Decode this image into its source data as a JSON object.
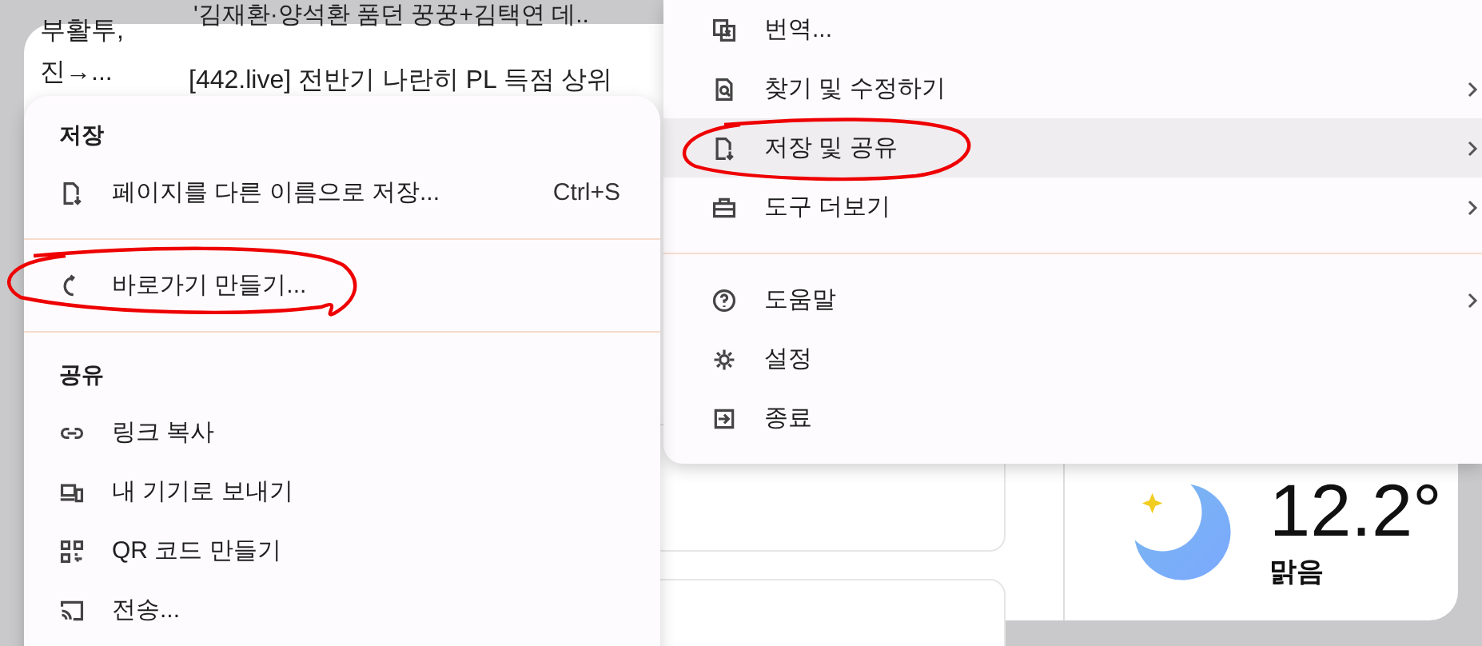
{
  "page": {
    "snippets": [
      "부활투,",
      "진→...",
      "'김재환·양석환 품던 꿍꿍+김택연 데..",
      "[442.live] 전반기 나란히 PL 득점 상위"
    ]
  },
  "weather": {
    "temperature": "12.2°",
    "condition": "맑음"
  },
  "main_menu": {
    "groups": [
      [
        {
          "label": "번역...",
          "submenu": false,
          "selected": false,
          "circled": false
        },
        {
          "label": "찾기 및 수정하기",
          "submenu": true,
          "selected": false,
          "circled": false
        },
        {
          "label": "저장 및 공유",
          "submenu": true,
          "selected": true,
          "circled": true
        },
        {
          "label": "도구 더보기",
          "submenu": true,
          "selected": false,
          "circled": false
        }
      ],
      [
        {
          "label": "도움말",
          "submenu": true,
          "selected": false,
          "circled": false
        },
        {
          "label": "설정",
          "submenu": false,
          "selected": false,
          "circled": false
        },
        {
          "label": "종료",
          "submenu": false,
          "selected": false,
          "circled": false
        }
      ]
    ]
  },
  "save_share_menu": {
    "sections": [
      {
        "title": "저장",
        "items": [
          {
            "label": "페이지를 다른 이름으로 저장...",
            "shortcut": "Ctrl+S",
            "circled": false
          }
        ]
      },
      {
        "items": [
          {
            "label": "바로가기 만들기...",
            "circled": true
          }
        ]
      },
      {
        "title": "공유",
        "items": [
          {
            "label": "링크 복사",
            "circled": false
          },
          {
            "label": "내 기기로 보내기",
            "circled": false
          },
          {
            "label": "QR 코드 만들기",
            "circled": false
          },
          {
            "label": "전송...",
            "circled": false
          }
        ]
      }
    ]
  }
}
